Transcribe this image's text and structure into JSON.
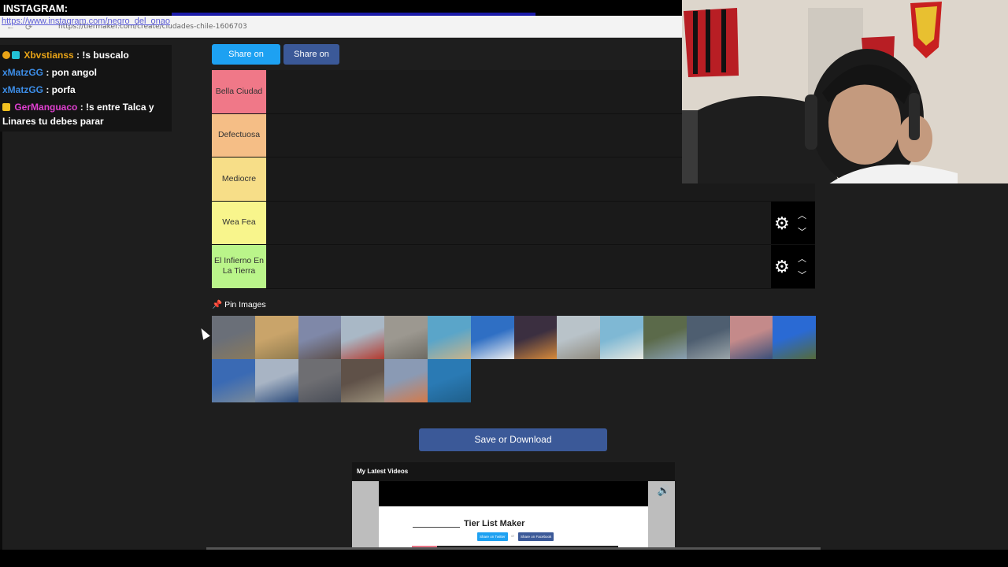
{
  "overlay": {
    "instagram_label": "INSTAGRAM:",
    "instagram_link": "https://www.instagram.com/negro_del_onao"
  },
  "browser": {
    "url": "https://tiermaker.com/create/ciudades-chile-1606703"
  },
  "chat": {
    "messages": [
      {
        "user": "Xbvstianss",
        "text": " : !s buscalo",
        "color": "#e8a317"
      },
      {
        "user": "xMatzGG",
        "text": " : pon angol",
        "color": "#3d8ee8"
      },
      {
        "user": "xMatzGG",
        "text": " : porfa",
        "color": "#3d8ee8"
      },
      {
        "user": "GerManguaco",
        "text": " : !s entre Talca y Linares tu debes parar",
        "color": "#e040d0"
      }
    ]
  },
  "page": {
    "share_twitter": "Share on Twitter",
    "share_fb": "Share on FB",
    "tiers": [
      {
        "label": "Bella Ciudad",
        "color": "#f07888"
      },
      {
        "label": "Defectuosa",
        "color": "#f5be86"
      },
      {
        "label": "Mediocre",
        "color": "#f7de88"
      },
      {
        "label": "Wea Fea",
        "color": "#f8f58c"
      },
      {
        "label": "El Infierno En La Tierra",
        "color": "#baf58a"
      }
    ],
    "pin_images": "Pin Images",
    "save_download": "Save or Download",
    "video": {
      "section_title": "My Latest Videos",
      "heading": "Tier List Maker",
      "btn_twitter": "Share on Twitter",
      "or": "or",
      "btn_fb": "Share on Facebook"
    }
  },
  "icons": {
    "gear": "gear-icon",
    "up": "chevron-up-icon",
    "down": "chevron-down-icon",
    "pin": "pin-icon",
    "mute": "speaker-icon"
  },
  "image_colors": [
    [
      "#6a6f78",
      "#8a7a5c"
    ],
    [
      "#c9a46a",
      "#8f7a4e"
    ],
    [
      "#7f88a8",
      "#5c4e49"
    ],
    [
      "#a9b8c6",
      "#b43a2e"
    ],
    [
      "#9c9890",
      "#6d6a62"
    ],
    [
      "#5aa5c9",
      "#c9b48a"
    ],
    [
      "#2f6fc4",
      "#f0f0f0"
    ],
    [
      "#3b2f40",
      "#d78a3a"
    ],
    [
      "#b9c3c9",
      "#8f8a7e"
    ],
    [
      "#7fb8d4",
      "#e8e8e0"
    ],
    [
      "#5b6a4a",
      "#8aa0b4"
    ],
    [
      "#4e5e70",
      "#9aa4a8"
    ],
    [
      "#c48a8a",
      "#3a4f7a"
    ],
    [
      "#2a6ad4",
      "#556a3a"
    ],
    [
      "#3a6ab4",
      "#7a8a9a"
    ],
    [
      "#a8b4c4",
      "#2a4a7a"
    ],
    [
      "#6e6e72",
      "#4a4e58"
    ],
    [
      "#5f5148",
      "#9a8f7a"
    ],
    [
      "#8a9ab4",
      "#d47a4a"
    ],
    [
      "#2a7ab4",
      "#1f5f8a"
    ]
  ]
}
